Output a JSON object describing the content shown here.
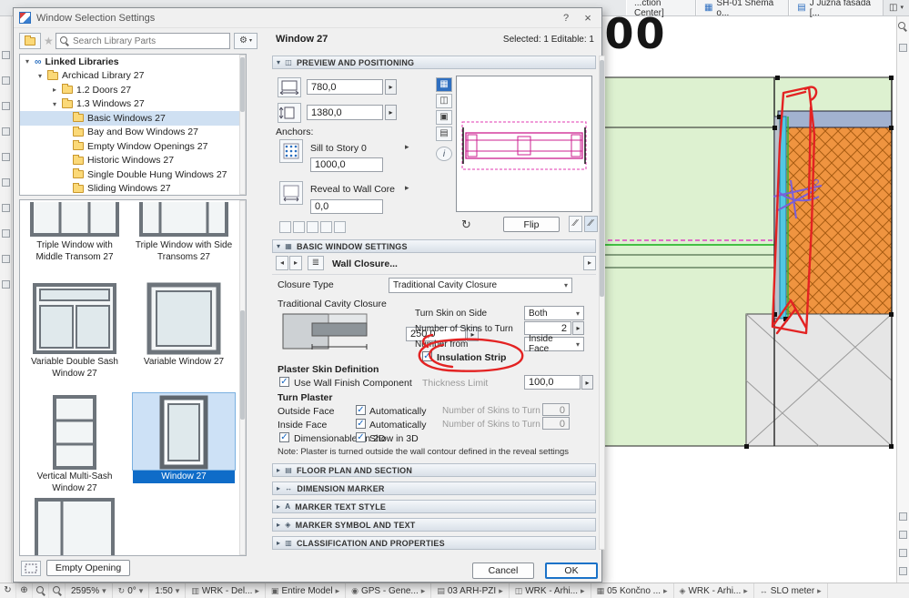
{
  "icons": {
    "close": "×",
    "help": "?"
  },
  "app": {
    "tabs": [
      "...ction Center]",
      "SH-01 Shema o...",
      "J Južna fasada [..."
    ],
    "dimension_text": ",00",
    "sketch_label": "2",
    "statusbar": {
      "zoom": "2595%",
      "rotation": "0°",
      "scale": "1:50",
      "segments": [
        "WRK - Del...",
        "Entire Model",
        "GPS - Gene...",
        "03 ARH-PZI",
        "WRK - Arhi...",
        "05 Končno ...",
        "WRK - Arhi...",
        "SLO meter"
      ]
    }
  },
  "dialog": {
    "title": "Window Selection Settings",
    "search_placeholder": "Search Library Parts",
    "tree": [
      "Linked Libraries",
      "Archicad Library 27",
      "1.2 Doors 27",
      "1.3 Windows 27",
      "Basic Windows 27",
      "Bay and Bow Windows 27",
      "Empty Window Openings 27",
      "Historic Windows 27",
      "Single Double Hung Windows 27",
      "Sliding Windows 27"
    ],
    "thumbs": [
      "Triple Window with Middle Transom 27",
      "Triple Window with Side Transoms 27",
      "Variable Double Sash Window 27",
      "Variable Window 27",
      "Vertical Multi-Sash Window 27",
      "Window 27"
    ],
    "empty_opening": "Empty Opening",
    "header_name": "Window 27",
    "header_selection": "Selected: 1 Editable: 1",
    "preview": {
      "section": "PREVIEW AND POSITIONING",
      "width": "780,0",
      "height": "1380,0",
      "anchors": "Anchors:",
      "sill": "Sill to Story 0",
      "sill_value": "1000,0",
      "reveal": "Reveal to Wall Core",
      "reveal_value": "0,0",
      "flip": "Flip"
    },
    "basic": {
      "section": "BASIC WINDOW SETTINGS",
      "subtab": "Wall Closure...",
      "closure_type_label": "Closure Type",
      "closure_type_value": "Traditional Cavity Closure",
      "tcc_label": "Traditional Cavity Closure",
      "tcc_value": "250,0",
      "turn_skin_label": "Turn Skin on Side",
      "turn_skin_value": "Both",
      "skins_label": "Number of Skins to Turn",
      "skins_value": "2",
      "number_from_label": "Number from",
      "number_from_value": "Inside Face",
      "insulation": "Insulation Strip",
      "plaster_heading": "Plaster Skin Definition",
      "use_wall_finish": "Use Wall Finish Component",
      "thickness_label": "Thickness Limit",
      "thickness_value": "100,0",
      "turn_plaster": "Turn Plaster",
      "outside_face": "Outside Face",
      "inside_face": "Inside Face",
      "automatically": "Automatically",
      "outside_skins": "0",
      "inside_skins": "0",
      "dimensionable": "Dimensionable on 2D",
      "show_3d": "Show in 3D",
      "note": "Note: Plaster is turned outside the wall contour defined in the reveal settings"
    },
    "sections": [
      "FLOOR PLAN AND SECTION",
      "DIMENSION MARKER",
      "MARKER TEXT STYLE",
      "MARKER SYMBOL AND TEXT",
      "CLASSIFICATION AND PROPERTIES"
    ],
    "cancel": "Cancel",
    "ok": "OK"
  }
}
